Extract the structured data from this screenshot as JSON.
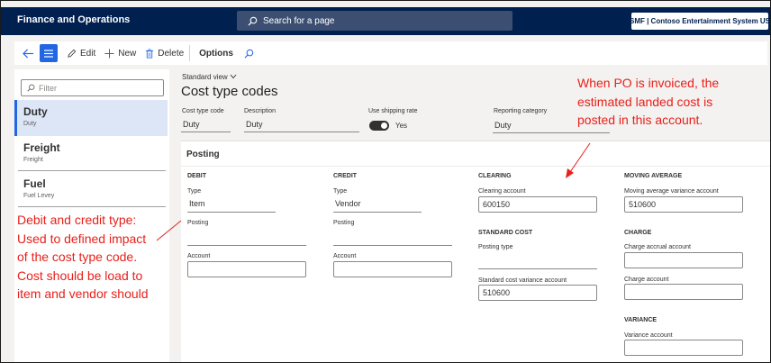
{
  "app": {
    "title": "Finance and Operations",
    "search_placeholder": "Search for a page",
    "company": "USMF | Contoso Entertainment System USA"
  },
  "actions": {
    "edit": "Edit",
    "new": "New",
    "delete": "Delete",
    "options": "Options"
  },
  "list": {
    "filter_placeholder": "Filter",
    "items": [
      {
        "title": "Duty",
        "subtitle": "Duty"
      },
      {
        "title": "Freight",
        "subtitle": "Freight"
      },
      {
        "title": "Fuel",
        "subtitle": "Fuel Levey"
      }
    ]
  },
  "header": {
    "view": "Standard view",
    "title": "Cost type codes",
    "fields": {
      "cost_type_code_label": "Cost type code",
      "cost_type_code": "Duty",
      "description_label": "Description",
      "description": "Duty",
      "shipping_rate_label": "Use shipping rate",
      "shipping_rate": "Yes",
      "reporting_category_label": "Reporting category",
      "reporting_category": "Duty"
    }
  },
  "posting": {
    "title": "Posting",
    "debit": {
      "heading": "DEBIT",
      "type_label": "Type",
      "type": "Item",
      "posting_label": "Posting",
      "account_label": "Account"
    },
    "credit": {
      "heading": "CREDIT",
      "type_label": "Type",
      "type": "Vendor",
      "posting_label": "Posting",
      "account_label": "Account"
    },
    "clearing": {
      "heading": "CLEARING",
      "account_label": "Clearing account",
      "account": "600150"
    },
    "standard_cost": {
      "heading": "STANDARD COST",
      "posting_type_label": "Posting type",
      "variance_label": "Standard cost variance account",
      "variance_account": "510600"
    },
    "moving_average": {
      "heading": "MOVING AVERAGE",
      "variance_label": "Moving average variance account",
      "variance_account": "510600"
    },
    "charge": {
      "heading": "CHARGE",
      "accrual_label": "Charge accrual account",
      "account_label": "Charge account"
    },
    "variance": {
      "heading": "VARIANCE",
      "account_label": "Variance account"
    }
  },
  "annotations": {
    "po_note": [
      "When PO is invoiced, the",
      "estimated landed cost is",
      "posted in this account."
    ],
    "type_note": [
      "Debit and credit type:",
      "Used to defined impact",
      "of the cost type code.",
      "Cost should be load to",
      "item and vendor should"
    ]
  },
  "colors": {
    "nav": "#002050",
    "accent": "#2266e3",
    "annotation": "#e8201a"
  }
}
